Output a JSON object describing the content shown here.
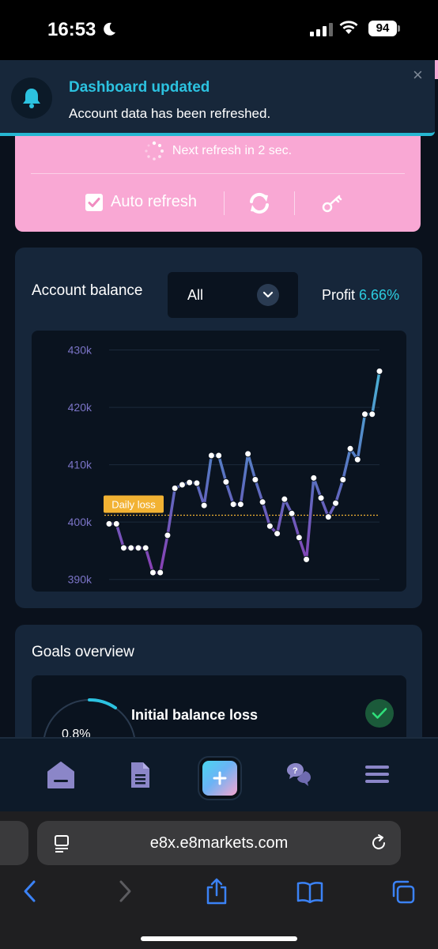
{
  "status_bar": {
    "time": "16:53",
    "battery": "94"
  },
  "toast": {
    "title": "Dashboard updated",
    "message": "Account data has been refreshed.",
    "close": "×"
  },
  "refresh": {
    "countdown_text": "Next refresh in 2 sec.",
    "auto_refresh_label": "Auto refresh",
    "auto_refresh_checked": true
  },
  "balance": {
    "title": "Account balance",
    "period_selected": "All",
    "profit_label": "Profit",
    "profit_value": "6.66%",
    "daily_loss_label": "Daily loss"
  },
  "chart_data": {
    "type": "line",
    "ylim": [
      389000,
      432000
    ],
    "y_ticks": [
      "430k",
      "420k",
      "410k",
      "400k",
      "390k"
    ],
    "y_tick_values": [
      430000,
      420000,
      410000,
      400000,
      390000
    ],
    "daily_loss_level": 401200,
    "grid": true,
    "series": [
      {
        "values": [
          399700,
          399700,
          395500,
          395500,
          395500,
          395500,
          391200,
          391200,
          397700,
          405900,
          406500,
          406900,
          406800,
          402900,
          411600,
          411600,
          407000,
          403100,
          403100,
          411900,
          407400,
          403500,
          399300,
          398000,
          404000,
          401500,
          397300,
          393500,
          407700,
          404200,
          400900,
          403300,
          407400,
          412800,
          410900,
          418800,
          418800,
          426300
        ]
      }
    ]
  },
  "goals": {
    "title": "Goals overview",
    "items": [
      {
        "name": "Initial balance loss",
        "percent": "0.8%"
      }
    ]
  },
  "safari": {
    "url": "e8x.e8markets.com"
  },
  "colors": {
    "accent": "#2ccde0",
    "pink": "#f9a8d4",
    "card": "#16263a",
    "nav_icon": "#8b86c8",
    "daily_loss": "#f2b233"
  }
}
